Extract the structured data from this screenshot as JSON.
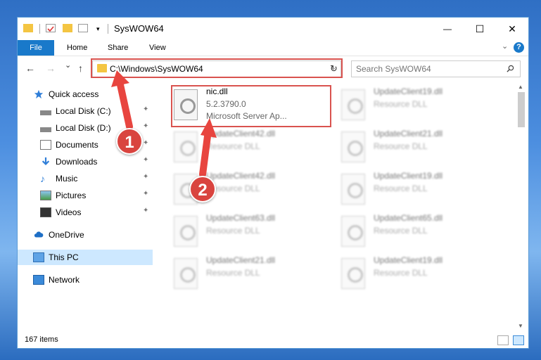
{
  "window": {
    "title": "SysWOW64",
    "controls": {
      "minimize": "—",
      "maximize": "☐",
      "close": "✕"
    }
  },
  "ribbon": {
    "tabs": [
      "File",
      "Home",
      "Share",
      "View"
    ],
    "help": "?"
  },
  "nav": {
    "back": "←",
    "forward": "→",
    "recent": "⌄",
    "up": "↑",
    "address": "C:\\Windows\\SysWOW64",
    "refresh": "↻",
    "search_placeholder": "Search SysWOW64"
  },
  "sidebar": {
    "items": [
      {
        "label": "Quick access",
        "icon": "star-icon",
        "pinned": false
      },
      {
        "label": "Local Disk (C:)",
        "icon": "drive-icon",
        "pinned": true
      },
      {
        "label": "Local Disk (D:)",
        "icon": "drive-icon",
        "pinned": true
      },
      {
        "label": "Documents",
        "icon": "documents-icon",
        "pinned": true
      },
      {
        "label": "Downloads",
        "icon": "download-icon",
        "pinned": true
      },
      {
        "label": "Music",
        "icon": "music-icon",
        "pinned": true
      },
      {
        "label": "Pictures",
        "icon": "pictures-icon",
        "pinned": true
      },
      {
        "label": "Videos",
        "icon": "videos-icon",
        "pinned": true
      },
      {
        "label": "OneDrive",
        "icon": "cloud-icon",
        "pinned": false
      },
      {
        "label": "This PC",
        "icon": "computer-icon",
        "pinned": false,
        "selected": true
      },
      {
        "label": "Network",
        "icon": "network-icon",
        "pinned": false
      }
    ],
    "pin_glyph": "📌"
  },
  "files": [
    {
      "name": "nic.dll",
      "version": "5.2.3790.0",
      "desc": "Microsoft Server Ap...",
      "focused": true
    },
    {
      "name": "UpdateClient19.dll",
      "desc": "Resource DLL"
    },
    {
      "name": "UpdateClient42.dll",
      "desc": "Resource DLL"
    },
    {
      "name": "UpdateClient21.dll",
      "desc": "Resource DLL"
    },
    {
      "name": "UpdateClient42.dll",
      "desc": "Resource DLL"
    },
    {
      "name": "UpdateClient19.dll",
      "desc": "Resource DLL"
    },
    {
      "name": "UpdateClient63.dll",
      "desc": "Resource DLL"
    },
    {
      "name": "UpdateClient65.dll",
      "desc": "Resource DLL"
    },
    {
      "name": "UpdateClient21.dll",
      "desc": "Resource DLL"
    },
    {
      "name": "UpdateClient19.dll",
      "desc": "Resource DLL"
    }
  ],
  "status": {
    "item_count": "167 items"
  },
  "annotations": {
    "step1": "1",
    "step2": "2"
  },
  "colors": {
    "accent": "#1979ca",
    "highlight": "#d9534f",
    "selection": "#cde8ff"
  }
}
